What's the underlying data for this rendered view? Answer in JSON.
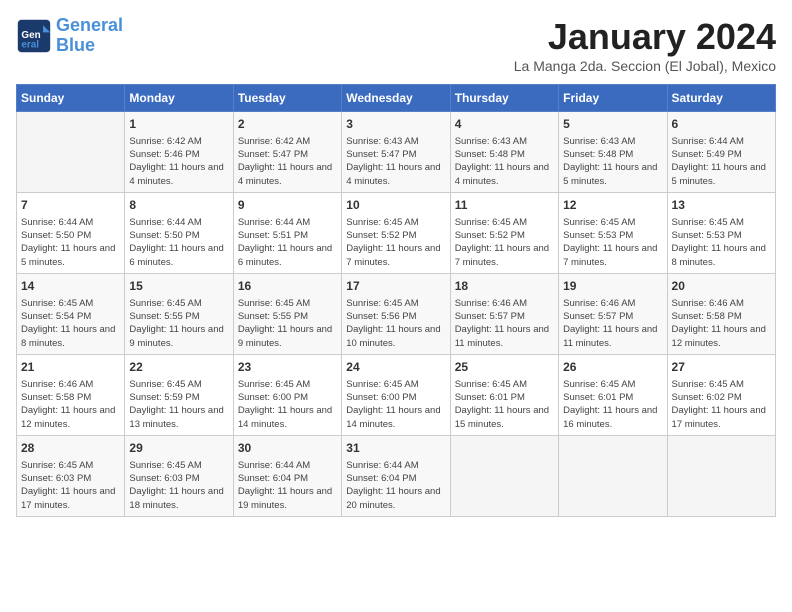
{
  "header": {
    "logo_line1": "General",
    "logo_line2": "Blue",
    "month": "January 2024",
    "location": "La Manga 2da. Seccion (El Jobal), Mexico"
  },
  "days_of_week": [
    "Sunday",
    "Monday",
    "Tuesday",
    "Wednesday",
    "Thursday",
    "Friday",
    "Saturday"
  ],
  "weeks": [
    [
      {
        "day": null
      },
      {
        "day": "1",
        "sunrise": "6:42 AM",
        "sunset": "5:46 PM",
        "daylight": "11 hours and 4 minutes."
      },
      {
        "day": "2",
        "sunrise": "6:42 AM",
        "sunset": "5:47 PM",
        "daylight": "11 hours and 4 minutes."
      },
      {
        "day": "3",
        "sunrise": "6:43 AM",
        "sunset": "5:47 PM",
        "daylight": "11 hours and 4 minutes."
      },
      {
        "day": "4",
        "sunrise": "6:43 AM",
        "sunset": "5:48 PM",
        "daylight": "11 hours and 4 minutes."
      },
      {
        "day": "5",
        "sunrise": "6:43 AM",
        "sunset": "5:48 PM",
        "daylight": "11 hours and 5 minutes."
      },
      {
        "day": "6",
        "sunrise": "6:44 AM",
        "sunset": "5:49 PM",
        "daylight": "11 hours and 5 minutes."
      }
    ],
    [
      {
        "day": "7",
        "sunrise": "6:44 AM",
        "sunset": "5:50 PM",
        "daylight": "11 hours and 5 minutes."
      },
      {
        "day": "8",
        "sunrise": "6:44 AM",
        "sunset": "5:50 PM",
        "daylight": "11 hours and 6 minutes."
      },
      {
        "day": "9",
        "sunrise": "6:44 AM",
        "sunset": "5:51 PM",
        "daylight": "11 hours and 6 minutes."
      },
      {
        "day": "10",
        "sunrise": "6:45 AM",
        "sunset": "5:52 PM",
        "daylight": "11 hours and 7 minutes."
      },
      {
        "day": "11",
        "sunrise": "6:45 AM",
        "sunset": "5:52 PM",
        "daylight": "11 hours and 7 minutes."
      },
      {
        "day": "12",
        "sunrise": "6:45 AM",
        "sunset": "5:53 PM",
        "daylight": "11 hours and 7 minutes."
      },
      {
        "day": "13",
        "sunrise": "6:45 AM",
        "sunset": "5:53 PM",
        "daylight": "11 hours and 8 minutes."
      }
    ],
    [
      {
        "day": "14",
        "sunrise": "6:45 AM",
        "sunset": "5:54 PM",
        "daylight": "11 hours and 8 minutes."
      },
      {
        "day": "15",
        "sunrise": "6:45 AM",
        "sunset": "5:55 PM",
        "daylight": "11 hours and 9 minutes."
      },
      {
        "day": "16",
        "sunrise": "6:45 AM",
        "sunset": "5:55 PM",
        "daylight": "11 hours and 9 minutes."
      },
      {
        "day": "17",
        "sunrise": "6:45 AM",
        "sunset": "5:56 PM",
        "daylight": "11 hours and 10 minutes."
      },
      {
        "day": "18",
        "sunrise": "6:46 AM",
        "sunset": "5:57 PM",
        "daylight": "11 hours and 11 minutes."
      },
      {
        "day": "19",
        "sunrise": "6:46 AM",
        "sunset": "5:57 PM",
        "daylight": "11 hours and 11 minutes."
      },
      {
        "day": "20",
        "sunrise": "6:46 AM",
        "sunset": "5:58 PM",
        "daylight": "11 hours and 12 minutes."
      }
    ],
    [
      {
        "day": "21",
        "sunrise": "6:46 AM",
        "sunset": "5:58 PM",
        "daylight": "11 hours and 12 minutes."
      },
      {
        "day": "22",
        "sunrise": "6:45 AM",
        "sunset": "5:59 PM",
        "daylight": "11 hours and 13 minutes."
      },
      {
        "day": "23",
        "sunrise": "6:45 AM",
        "sunset": "6:00 PM",
        "daylight": "11 hours and 14 minutes."
      },
      {
        "day": "24",
        "sunrise": "6:45 AM",
        "sunset": "6:00 PM",
        "daylight": "11 hours and 14 minutes."
      },
      {
        "day": "25",
        "sunrise": "6:45 AM",
        "sunset": "6:01 PM",
        "daylight": "11 hours and 15 minutes."
      },
      {
        "day": "26",
        "sunrise": "6:45 AM",
        "sunset": "6:01 PM",
        "daylight": "11 hours and 16 minutes."
      },
      {
        "day": "27",
        "sunrise": "6:45 AM",
        "sunset": "6:02 PM",
        "daylight": "11 hours and 17 minutes."
      }
    ],
    [
      {
        "day": "28",
        "sunrise": "6:45 AM",
        "sunset": "6:03 PM",
        "daylight": "11 hours and 17 minutes."
      },
      {
        "day": "29",
        "sunrise": "6:45 AM",
        "sunset": "6:03 PM",
        "daylight": "11 hours and 18 minutes."
      },
      {
        "day": "30",
        "sunrise": "6:44 AM",
        "sunset": "6:04 PM",
        "daylight": "11 hours and 19 minutes."
      },
      {
        "day": "31",
        "sunrise": "6:44 AM",
        "sunset": "6:04 PM",
        "daylight": "11 hours and 20 minutes."
      },
      {
        "day": null
      },
      {
        "day": null
      },
      {
        "day": null
      }
    ]
  ]
}
